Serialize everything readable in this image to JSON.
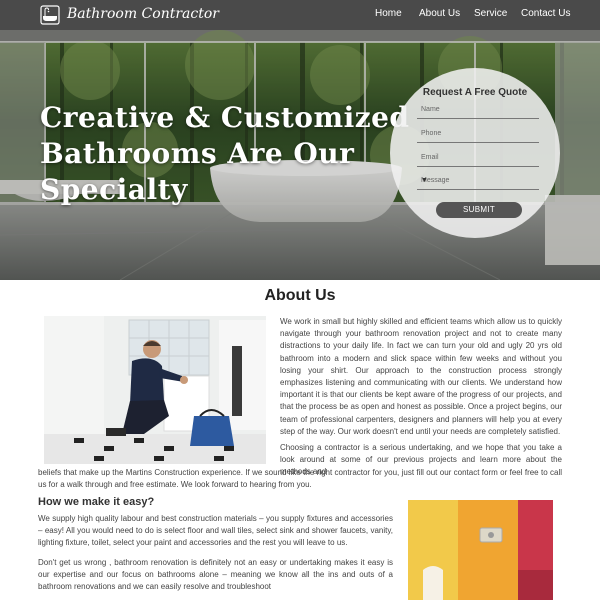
{
  "header": {
    "logo_text": "Bathroom Contractor",
    "menu": [
      "Home",
      "About Us",
      "Service",
      "Contact Us"
    ]
  },
  "hero": {
    "headline": [
      "Creative & Customized",
      "Bathrooms Are Our",
      "Specialty"
    ]
  },
  "quote_form": {
    "title": "Request A Free Quote",
    "name_placeholder": "Name",
    "phone_placeholder": "Phone",
    "email_placeholder": "Email",
    "message_placeholder": "Message",
    "submit_label": "SUBMIT"
  },
  "about": {
    "title": "About Us",
    "para1": "We work in small but highly skilled and efficient teams which allow us to quickly navigate through your bathroom renovation project and not to create many distractions to your daily life. In fact we can turn your old and ugly 20 yrs old bathroom into a modern and slick space within few weeks and without you losing your shirt. Our approach to the construction process strongly emphasizes listening and communicating with our clients. We understand how important it is that our clients be kept aware of the progress of our projects, and that the process be as open and honest as possible. Once a project begins, our team of professional carpenters, designers and planners will help you at every step of the way. Our work doesn't end until your needs are completely satisfied.",
    "para2a": "Choosing a contractor is a serious undertaking, and we hope that you take a look around at some of our previous projects and learn more about the methods and",
    "para2b": "beliefs that make up the Martins Construction experience. If we sound like the right contractor for you, just fill out our contact form or feel free to call us for a walk through and free estimate. We look forward to hearing from you."
  },
  "how": {
    "title": "How we make it easy?",
    "para1": "We supply high quality labour and best construction materials – you supply fixtures and accessories – easy! All you would need to do is select floor and wall tiles, select sink and shower faucets, vanity, lighting fixture, toilet, select your paint and accessories and the rest you will leave to us.",
    "para2": "Don't get us wrong , bathroom renovation is definitely not an easy or undertaking  makes it easy is our expertise and our focus on bathrooms alone – meaning we know all the ins and outs of a bathroom renovations and we can easily resolve and troubleshoot"
  },
  "icons": {
    "logo": "bathtub-icon",
    "dropdown": "caret-down-icon"
  },
  "colors": {
    "nav_bg": "#4a4a4a",
    "submit_bg": "#555555"
  }
}
